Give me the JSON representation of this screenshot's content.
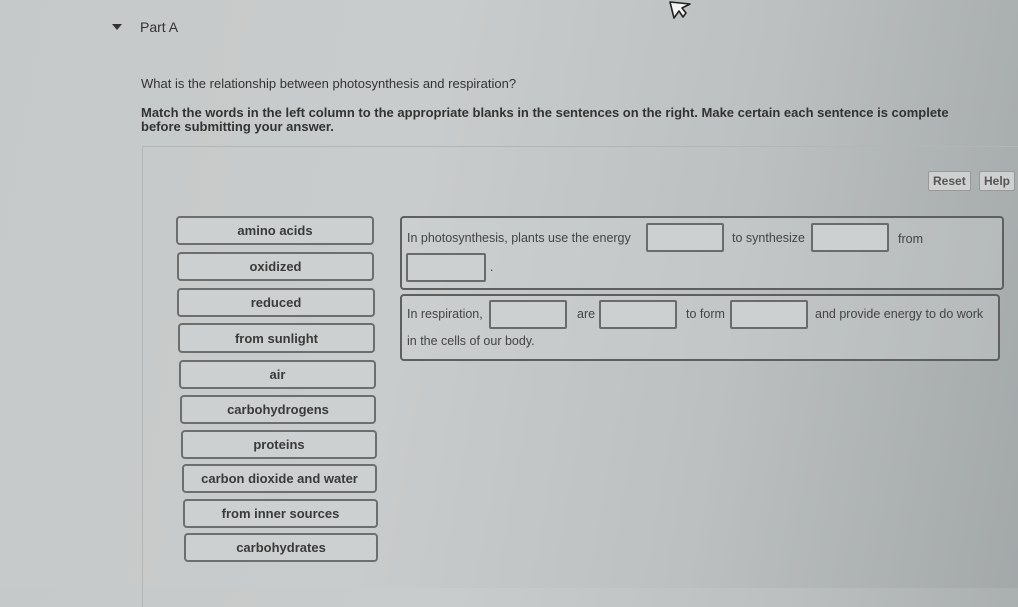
{
  "part": {
    "title": "Part A",
    "expanded": true
  },
  "question": "What is the relationship between photosynthesis and respiration?",
  "instructions": "Match the words in the left column to the appropriate blanks in the sentences on the right. Make certain each sentence is complete before submitting your answer.",
  "controls": {
    "reset_label": "Reset",
    "help_label": "Help"
  },
  "word_bank": [
    "amino acids",
    "oxidized",
    "reduced",
    "from sunlight",
    "air",
    "carbohydrogens",
    "proteins",
    "carbon dioxide and water",
    "from inner sources",
    "carbohydrates"
  ],
  "sentences": [
    {
      "segments": [
        "In photosynthesis, plants use the energy",
        "to synthesize",
        "from",
        "."
      ],
      "blanks": [
        "",
        "",
        ""
      ]
    },
    {
      "segments": [
        "In respiration,",
        "are",
        "to form",
        "and provide energy to do work",
        "in the cells of our body."
      ],
      "blanks": [
        "",
        "",
        ""
      ]
    }
  ]
}
